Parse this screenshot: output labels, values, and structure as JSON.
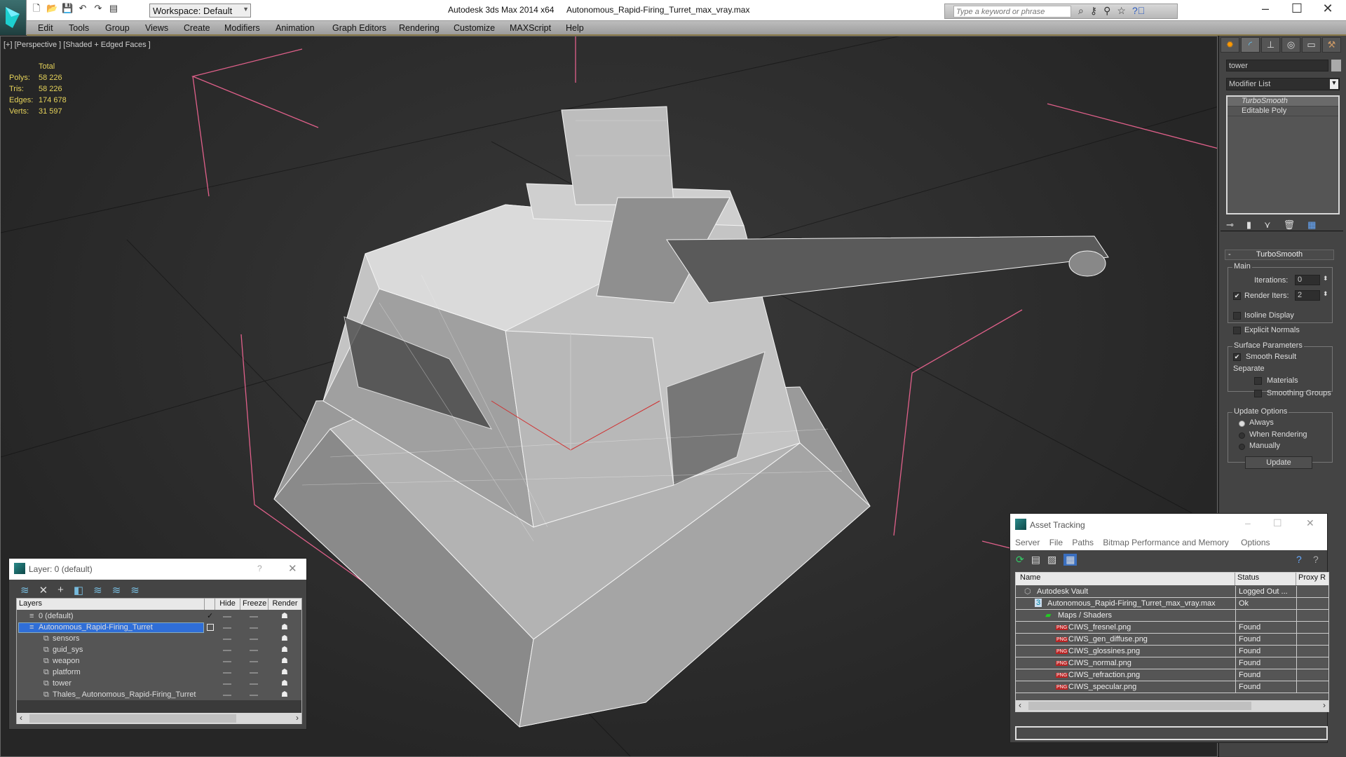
{
  "window": {
    "app_title": "Autodesk 3ds Max 2014 x64",
    "file_title": "Autonomous_Rapid-Firing_Turret_max_vray.max",
    "workspace": "Workspace: Default",
    "search_placeholder": "Type a keyword or phrase"
  },
  "menu": [
    "Edit",
    "Tools",
    "Group",
    "Views",
    "Create",
    "Modifiers",
    "Animation",
    "Graph Editors",
    "Rendering",
    "Customize",
    "MAXScript",
    "Help"
  ],
  "viewport": {
    "label": "[+] [Perspective ] [Shaded + Edged Faces ]",
    "stats": {
      "header": "Total",
      "rows": [
        {
          "k": "Polys:",
          "v": "58 226"
        },
        {
          "k": "Tris:",
          "v": "58 226"
        },
        {
          "k": "Edges:",
          "v": "174 678"
        },
        {
          "k": "Verts:",
          "v": "31 597"
        }
      ]
    }
  },
  "command_panel": {
    "object_name": "tower",
    "modifier_list": "Modifier List",
    "stack": [
      "TurboSmooth",
      "Editable Poly"
    ],
    "rollout": "TurboSmooth",
    "main": {
      "title": "Main",
      "iterations_label": "Iterations:",
      "iterations": "0",
      "render_iters_label": "Render Iters:",
      "render_iters": "2",
      "render_iters_checked": true,
      "isoline": "Isoline Display",
      "explicit": "Explicit Normals"
    },
    "surface": {
      "title": "Surface Parameters",
      "smooth_result": "Smooth Result",
      "smooth_checked": true,
      "separate": "Separate",
      "materials": "Materials",
      "smoothing_groups": "Smoothing Groups"
    },
    "update": {
      "title": "Update Options",
      "options": [
        "Always",
        "When Rendering",
        "Manually"
      ],
      "selected": "Always",
      "button": "Update"
    }
  },
  "layer_dialog": {
    "title": "Layer: 0 (default)",
    "help": "?",
    "close": "✕",
    "columns": [
      "Layers",
      "Hide",
      "Freeze",
      "Render"
    ],
    "rows": [
      {
        "name": "0 (default)",
        "level": 0,
        "active": true
      },
      {
        "name": "Autonomous_Rapid-Firing_Turret",
        "level": 0,
        "selected": true
      },
      {
        "name": "sensors",
        "level": 1
      },
      {
        "name": "guid_sys",
        "level": 1
      },
      {
        "name": "weapon",
        "level": 1
      },
      {
        "name": "platform",
        "level": 1
      },
      {
        "name": "tower",
        "level": 1
      },
      {
        "name": "Thales_ Autonomous_Rapid-Firing_Turret",
        "level": 1
      }
    ]
  },
  "asset_tracking": {
    "title": "Asset Tracking",
    "menu": [
      "Server",
      "File",
      "Paths",
      "Bitmap Performance and Memory",
      "Options"
    ],
    "columns": [
      "Name",
      "Status",
      "Proxy R"
    ],
    "rows": [
      {
        "name": "Autodesk Vault",
        "status": "Logged Out ...",
        "level": 0
      },
      {
        "name": "Autonomous_Rapid-Firing_Turret_max_vray.max",
        "status": "Ok",
        "level": 1
      },
      {
        "name": "Maps / Shaders",
        "status": "",
        "level": 2
      },
      {
        "name": "CIWS_fresnel.png",
        "status": "Found",
        "level": 3
      },
      {
        "name": "CIWS_gen_diffuse.png",
        "status": "Found",
        "level": 3
      },
      {
        "name": "CIWS_glossines.png",
        "status": "Found",
        "level": 3
      },
      {
        "name": "CIWS_normal.png",
        "status": "Found",
        "level": 3
      },
      {
        "name": "CIWS_refraction.png",
        "status": "Found",
        "level": 3
      },
      {
        "name": "CIWS_specular.png",
        "status": "Found",
        "level": 3
      }
    ]
  }
}
